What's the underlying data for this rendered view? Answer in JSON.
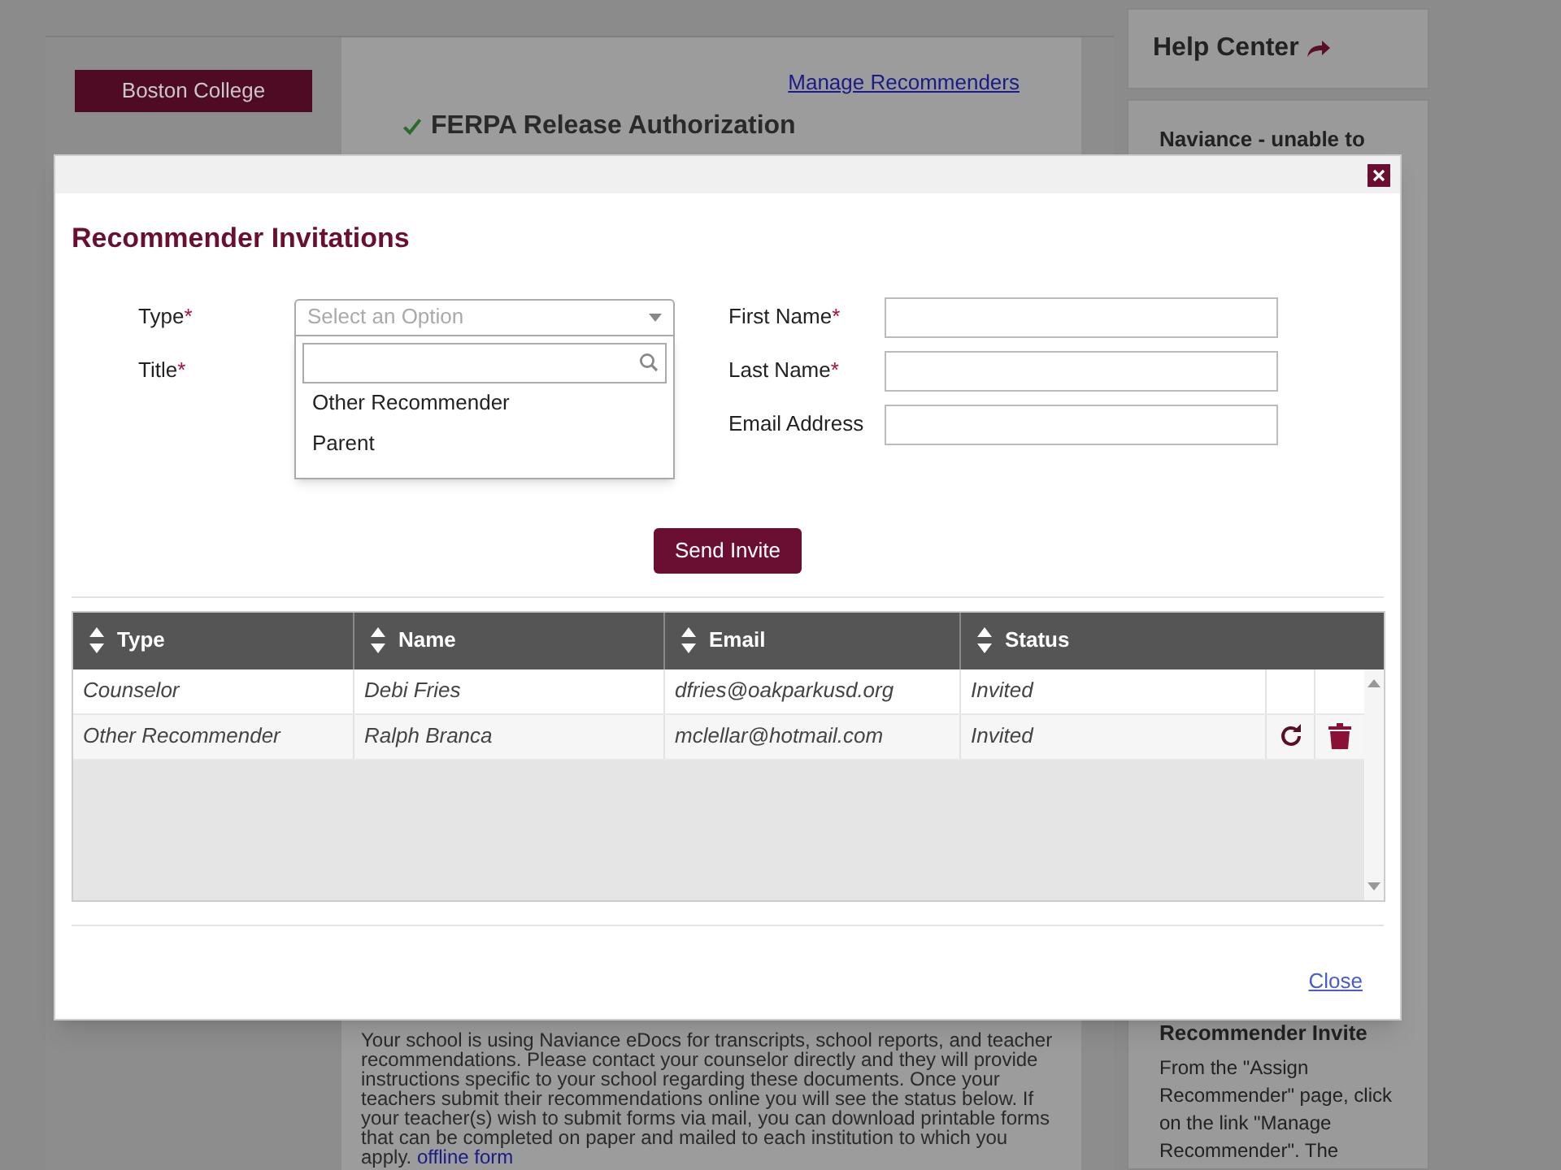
{
  "sidebar": {
    "school": "Boston College"
  },
  "main": {
    "manage_link": "Manage Recommenders",
    "section_title": "FERPA Release Authorization",
    "section_done": true,
    "paragraph": "Your school is using Naviance eDocs for transcripts, school reports, and teacher recommendations. Please contact your counselor directly and they will provide instructions specific to your school regarding these documents. Once your teachers submit their recommendations online you will see the status below. If your teacher(s) wish to submit forms via mail, you can download printable forms that can be completed on paper and mailed to each institution to which you apply.",
    "paragraph_link": "offline form"
  },
  "help": {
    "title": "Help Center",
    "article_title": "Naviance - unable to",
    "topic_title": "Recommender Invite",
    "topic_text": "From the \"Assign Recommender\" page, click on the link \"Manage Recommender\". The"
  },
  "modal": {
    "title": "Recommender Invitations",
    "required_mark": "*",
    "left_fields": [
      {
        "label": "Type",
        "required": true,
        "kind": "select",
        "placeholder": "Select an Option",
        "expanded": true,
        "options": [
          {
            "label": "Other Recommender"
          },
          {
            "label": "Parent"
          }
        ]
      },
      {
        "label": "Title",
        "required": true,
        "kind": "hidden"
      }
    ],
    "right_fields": [
      {
        "label": "First Name",
        "required": true,
        "kind": "text"
      },
      {
        "label": "Last Name",
        "required": true,
        "kind": "text"
      },
      {
        "label": "Email Address",
        "required": false,
        "kind": "text"
      }
    ],
    "send_button": "Send Invite",
    "table": {
      "columns": [
        {
          "label": "Type"
        },
        {
          "label": "Name"
        },
        {
          "label": "Email"
        },
        {
          "label": "Status"
        }
      ],
      "rows": [
        {
          "cells": [
            "Counselor",
            "Debi Fries",
            "dfries@oakparkusd.org",
            "Invited"
          ],
          "actions": false
        },
        {
          "cells": [
            "Other Recommender",
            "Ralph Branca",
            "mclellar@hotmail.com",
            "Invited"
          ],
          "actions": true
        }
      ]
    },
    "close_link": "Close"
  }
}
